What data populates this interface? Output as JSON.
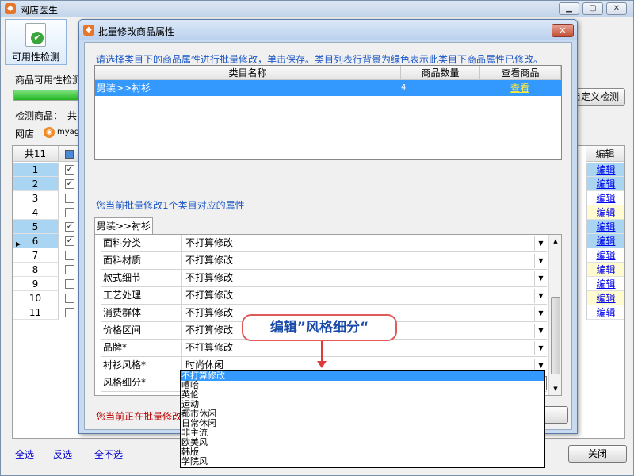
{
  "app": {
    "title": "网店医生",
    "toolbar_button": "可用性检测",
    "labels": {
      "availability": "商品可用性检测",
      "detect": "检测商品：",
      "detect_value": "共",
      "shop": "网店",
      "shop_name": "myagu"
    },
    "custom_button": "自定义检测",
    "progress_fraction": 0.95,
    "grid": {
      "count_header": "共11",
      "edit_header": "编辑",
      "rows": [
        {
          "num": "1",
          "checked": true,
          "selected": true,
          "edit": "编辑",
          "edit_bg": "blue"
        },
        {
          "num": "2",
          "checked": true,
          "selected": true,
          "edit": "编辑",
          "edit_bg": "blue"
        },
        {
          "num": "3",
          "checked": false,
          "selected": false,
          "edit": "编辑",
          "edit_bg": ""
        },
        {
          "num": "4",
          "checked": false,
          "selected": false,
          "edit": "编辑",
          "edit_bg": "yellow"
        },
        {
          "num": "5",
          "checked": true,
          "selected": true,
          "edit": "编辑",
          "edit_bg": "blue"
        },
        {
          "num": "6",
          "checked": true,
          "selected": true,
          "edit": "编辑",
          "edit_bg": "blue",
          "pointer": true
        },
        {
          "num": "7",
          "checked": false,
          "selected": false,
          "edit": "编辑",
          "edit_bg": ""
        },
        {
          "num": "8",
          "checked": false,
          "selected": false,
          "edit": "编辑",
          "edit_bg": "yellow"
        },
        {
          "num": "9",
          "checked": false,
          "selected": false,
          "edit": "编辑",
          "edit_bg": ""
        },
        {
          "num": "10",
          "checked": false,
          "selected": false,
          "edit": "编辑",
          "edit_bg": "yellow"
        },
        {
          "num": "11",
          "checked": false,
          "selected": false,
          "edit": "编辑",
          "edit_bg": ""
        }
      ]
    },
    "bottom": {
      "select_all": "全选",
      "invert": "反选",
      "select_none": "全不选",
      "close": "关闭"
    }
  },
  "dialog": {
    "title": "批量修改商品属性",
    "close": "✕",
    "instruction": "请选择类目下的商品属性进行批量修改，单击保存。类目列表行背景为绿色表示此类目下商品属性已修改。",
    "category_grid": {
      "headers": [
        "类目名称",
        "商品数量",
        "查看商品"
      ],
      "rows": [
        {
          "name": "男装>>衬衫",
          "count": "4",
          "view": "查看"
        }
      ]
    },
    "attr_count_text": "您当前批量修改1个类目对应的属性",
    "tab": "男装>>衬衫",
    "attributes": [
      {
        "name": "面料分类",
        "value": "不打算修改"
      },
      {
        "name": "面料材质",
        "value": "不打算修改"
      },
      {
        "name": "款式细节",
        "value": "不打算修改"
      },
      {
        "name": "工艺处理",
        "value": "不打算修改"
      },
      {
        "name": "消费群体",
        "value": "不打算修改"
      },
      {
        "name": "价格区间",
        "value": "不打算修改"
      },
      {
        "name": "品牌*",
        "value": "不打算修改"
      },
      {
        "name": "衬衫风格*",
        "value": "时尚休闲"
      },
      {
        "name": "风格细分*",
        "value": "不打算修改",
        "active": true
      }
    ],
    "status_text": "您当前正在批量修改",
    "dropdown_options": [
      "不打算修改",
      "嘻哈",
      "英伦",
      "运动",
      "都市休闲",
      "日常休闲",
      "非主流",
      "欧美风",
      "韩版",
      "学院风"
    ]
  },
  "annotation": "编辑”风格细分“"
}
